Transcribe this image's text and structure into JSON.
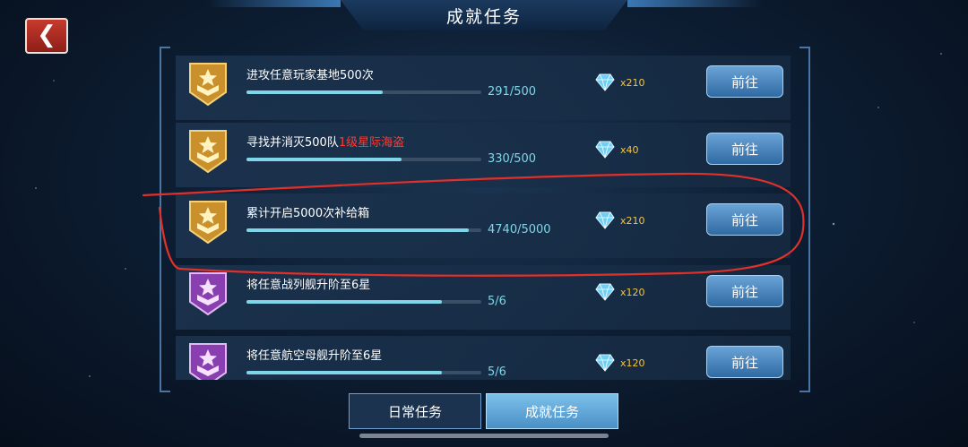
{
  "header": {
    "title": "成就任务",
    "back_icon": "chevron-left-icon"
  },
  "tasks": [
    {
      "badge": "gold-star-badge-icon",
      "label": "进攻任意玩家基地500次",
      "label_highlight": "",
      "progress_text": "291/500",
      "progress": 0.582,
      "reward_icon": "diamond-icon",
      "reward_count": "x210",
      "button": "前往"
    },
    {
      "badge": "gold-star-badge-icon",
      "label": "寻找并消灭500队",
      "label_highlight": "1级星际海盗",
      "progress_text": "330/500",
      "progress": 0.66,
      "reward_icon": "diamond-icon",
      "reward_count": "x40",
      "button": "前往"
    },
    {
      "badge": "gold-star-badge-icon",
      "label": "累计开启5000次补给箱",
      "label_highlight": "",
      "progress_text": "4740/5000",
      "progress": 0.948,
      "reward_icon": "diamond-icon",
      "reward_count": "x210",
      "button": "前往"
    },
    {
      "badge": "purple-star-badge-icon",
      "label": "将任意战列舰升阶至6星",
      "label_highlight": "",
      "progress_text": "5/6",
      "progress": 0.833,
      "reward_icon": "diamond-icon",
      "reward_count": "x120",
      "button": "前往"
    },
    {
      "badge": "purple-star-badge-icon",
      "label": "将任意航空母舰升阶至6星",
      "label_highlight": "",
      "progress_text": "5/6",
      "progress": 0.833,
      "reward_icon": "diamond-icon",
      "reward_count": "x120",
      "button": "前往"
    }
  ],
  "tabs": [
    {
      "label": "日常任务",
      "active": false
    },
    {
      "label": "成就任务",
      "active": true
    }
  ],
  "colors": {
    "progress": "#7fd6e8",
    "highlight": "#ff3b30",
    "reward": "#f5c542",
    "annotation": "#e0302a"
  }
}
